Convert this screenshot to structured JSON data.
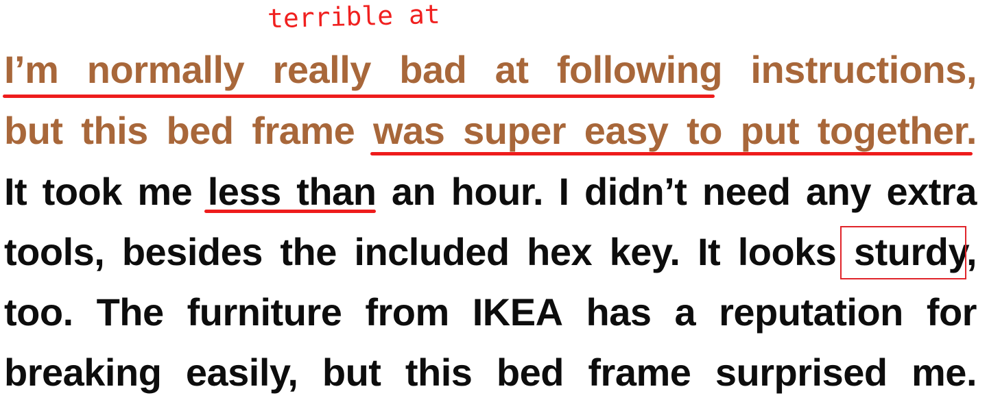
{
  "annotation": {
    "handwritten_note": "terrible at",
    "ink_color": "#ee1c1c"
  },
  "text": {
    "highlight_color": "#a8673a",
    "body_color": "#0d0d0d",
    "lines": [
      {
        "words": [
          "I’m",
          "normally",
          "really",
          "bad",
          "at",
          "following",
          "instructions,"
        ]
      },
      {
        "words": [
          "but",
          "this",
          "bed",
          "frame",
          "was",
          "super",
          "easy",
          "to",
          "put",
          "together."
        ]
      },
      {
        "words": [
          "It",
          "took",
          "me",
          "less",
          "than",
          "an",
          "hour.",
          "I",
          "didn’t",
          "need",
          "any",
          "extra"
        ]
      },
      {
        "words": [
          "tools,",
          "besides",
          "the",
          "included",
          "hex",
          "key.",
          "It",
          "looks",
          "sturdy,"
        ]
      },
      {
        "words": [
          "too.",
          "The",
          "furniture",
          "from",
          "IKEA",
          "has",
          "a",
          "reputation",
          "for"
        ]
      },
      {
        "words": [
          "breaking",
          "easily,",
          "but",
          "this",
          "bed",
          "frame",
          "surprised",
          "me."
        ]
      }
    ]
  },
  "marks": {
    "underlined_phrases": [
      "I’m normally really bad at following",
      "was super easy to put together.",
      "less than"
    ],
    "boxed_word": "sturdy"
  }
}
